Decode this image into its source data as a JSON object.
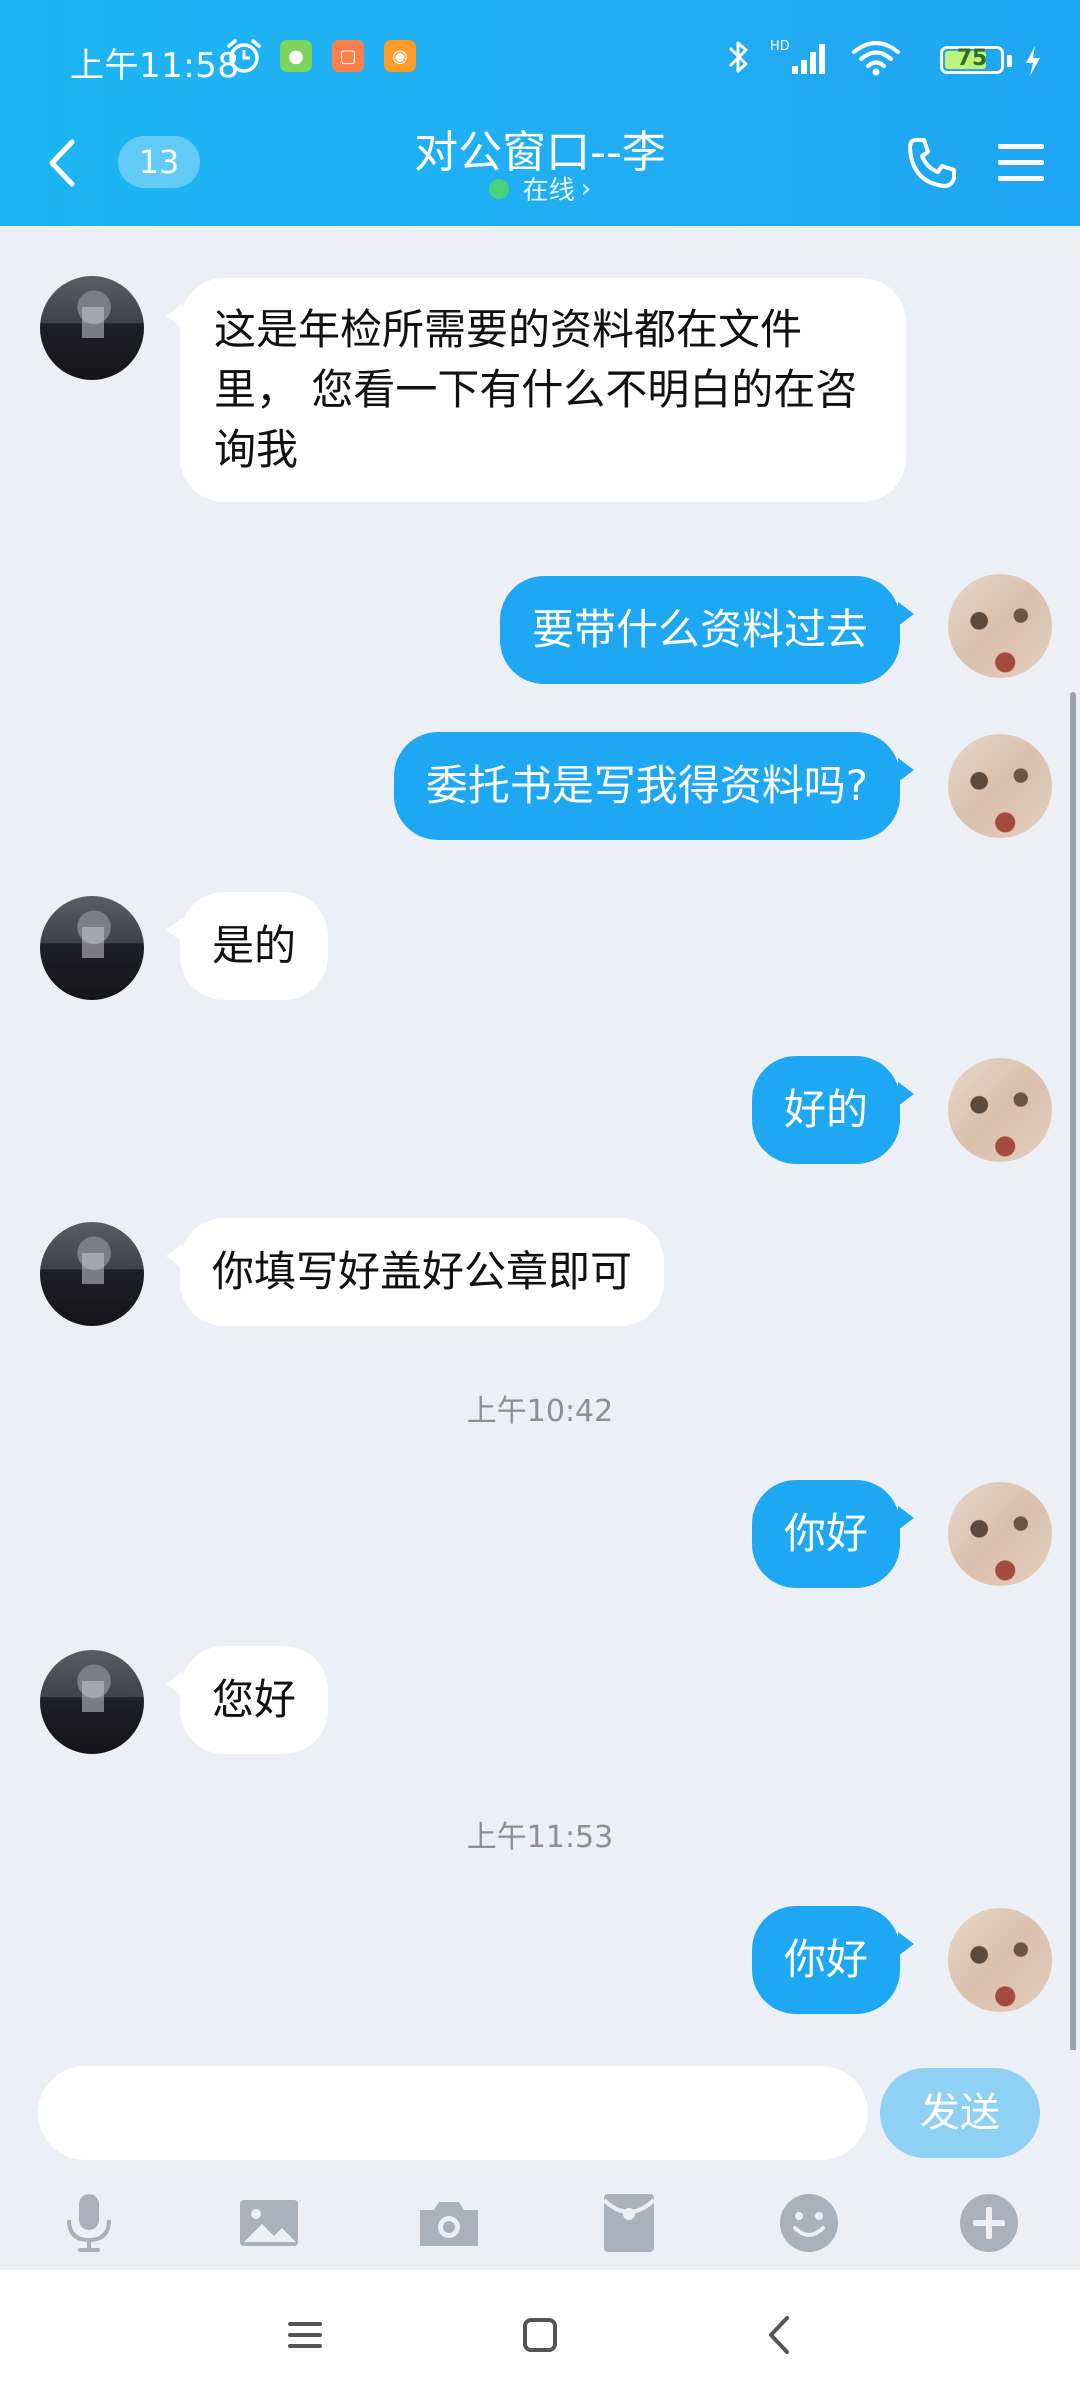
{
  "status_bar": {
    "time": "上午11:58",
    "battery_level": "75",
    "battery_fraction": 0.75,
    "network_label": "HD",
    "icons": [
      "alarm-icon",
      "wechat-icon",
      "mi-store-icon",
      "taobao-icon",
      "bluetooth-icon",
      "signal-icon",
      "wifi-icon",
      "battery-icon",
      "charging-icon"
    ]
  },
  "header": {
    "unread_count": "13",
    "title": "对公窗口--李",
    "presence": "在线",
    "presence_chevron": "›",
    "accent_color": "#1cb6f4"
  },
  "messages": [
    {
      "side": "in",
      "text": "这是年检所需要的资料都在文件里， 您看一下有什么不明白的在咨询我"
    },
    {
      "side": "out",
      "text": "要带什么资料过去"
    },
    {
      "side": "out",
      "text": "委托书是写我得资料吗?"
    },
    {
      "side": "in",
      "text": "是的"
    },
    {
      "side": "out",
      "text": "好的"
    },
    {
      "side": "in",
      "text": "你填写好盖好公章即可"
    },
    {
      "type": "time",
      "text": "上午10:42"
    },
    {
      "side": "out",
      "text": "你好"
    },
    {
      "side": "in",
      "text": "您好"
    },
    {
      "type": "time",
      "text": "上午11:53"
    },
    {
      "side": "out",
      "text": "你好"
    }
  ],
  "composer": {
    "input_value": "",
    "send_label": "发送",
    "tools": [
      "microphone-icon",
      "image-icon",
      "camera-icon",
      "red-packet-icon",
      "emoji-icon",
      "plus-icon"
    ]
  },
  "colors": {
    "outgoing_bubble": "#1ea7f2",
    "incoming_bubble": "#ffffff",
    "chat_background": "#eceff5",
    "send_button": "#8fd1f5"
  }
}
